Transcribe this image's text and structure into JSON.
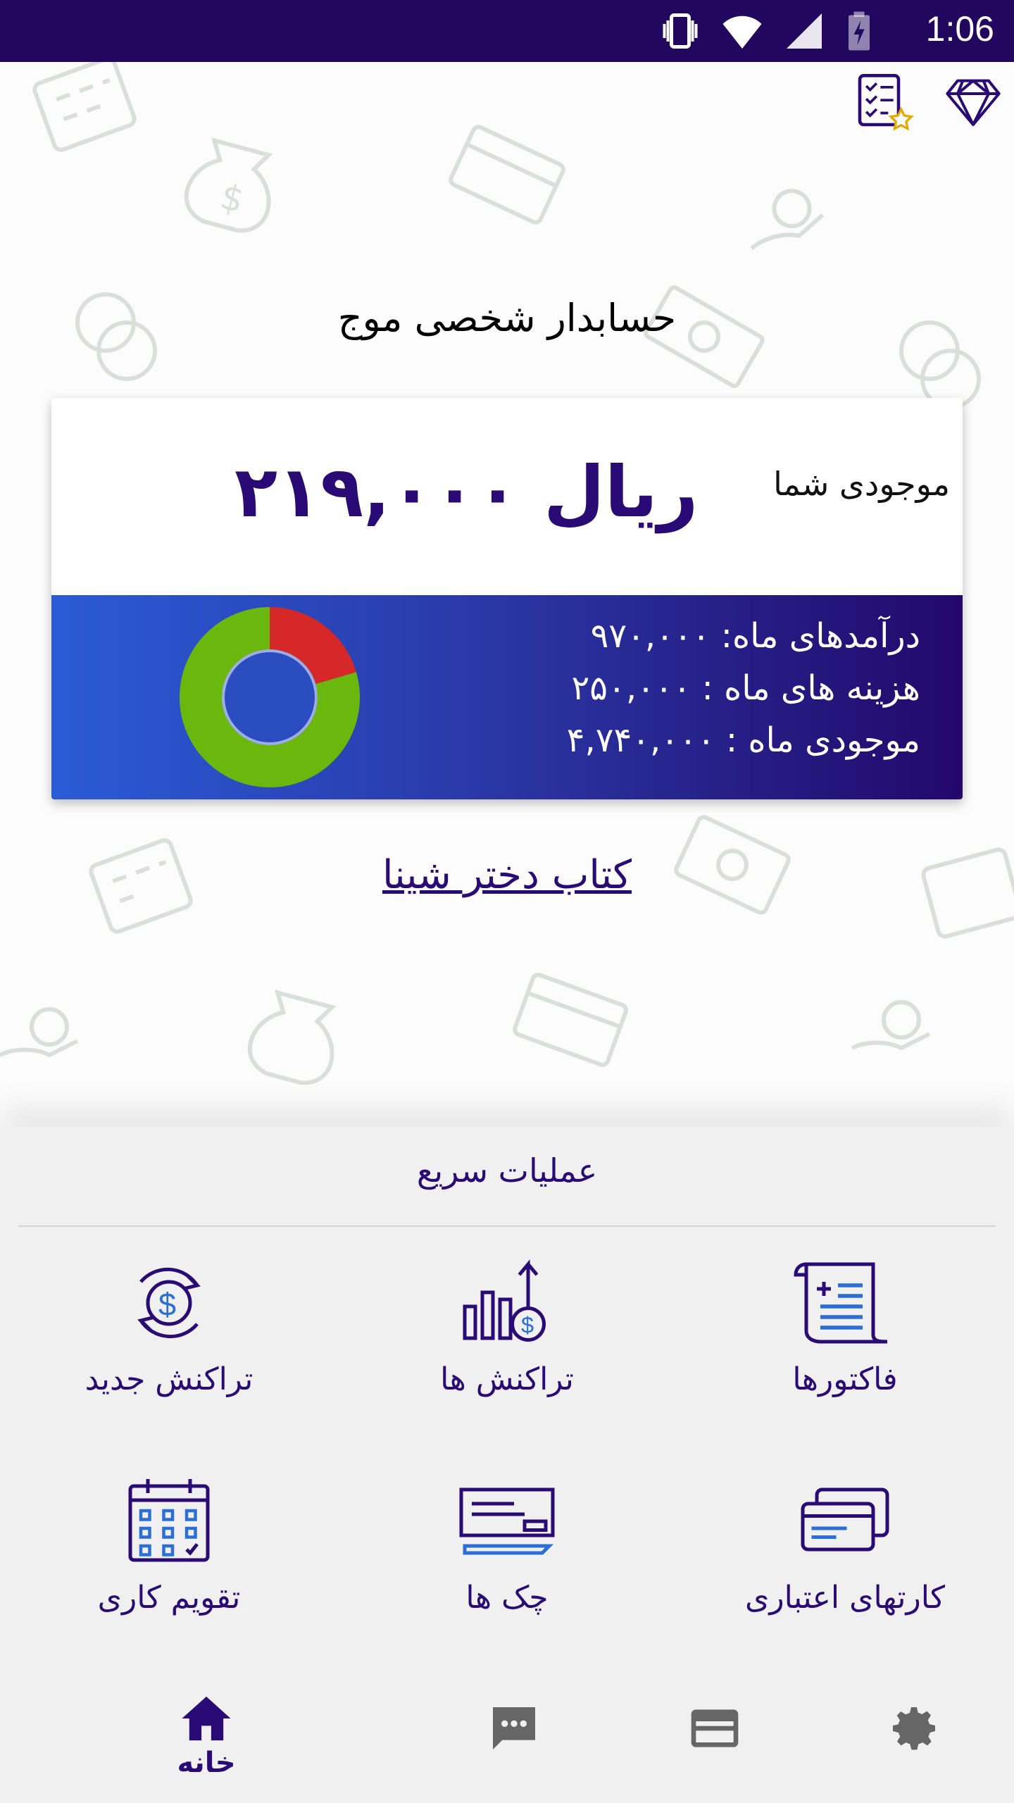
{
  "status_bar": {
    "time": "1:06",
    "icons": [
      "vibrate-icon",
      "wifi-icon",
      "signal-icon",
      "battery-charging-icon"
    ]
  },
  "header": {
    "icons": [
      "checklist-star-icon",
      "diamond-icon"
    ]
  },
  "app": {
    "title": "حسابدار شخصی موج"
  },
  "balance_card": {
    "label": "موجودی شما",
    "value": "۲۱۹,۰۰۰ ریال",
    "summary": {
      "income": "درآمدهای ماه: ۹۷۰,۰۰۰",
      "expense": "هزینه های ماه : ۲۵۰,۰۰۰",
      "balance": "موجودی ماه : ۴,۷۴۰,۰۰۰"
    },
    "donut": {
      "income_value": 970000,
      "expense_value": 250000,
      "income_color": "#6ab80e",
      "expense_color": "#d62828"
    }
  },
  "link": {
    "book": "کتاب دختر شینا"
  },
  "quick_actions": {
    "title": "عملیات سریع",
    "items": [
      {
        "label": "فاکتورها",
        "icon": "invoice-scroll-icon"
      },
      {
        "label": "تراکنش ها",
        "icon": "transactions-chart-icon"
      },
      {
        "label": "تراکنش جدید",
        "icon": "new-transaction-icon"
      },
      {
        "label": "کارتهای اعتباری",
        "icon": "credit-cards-icon"
      },
      {
        "label": "چک ها",
        "icon": "cheque-icon"
      },
      {
        "label": "تقویم کاری",
        "icon": "calendar-icon"
      }
    ]
  },
  "bottom_nav": {
    "items": [
      {
        "label": "خانه",
        "icon": "home-icon",
        "active": true
      },
      {
        "label": "",
        "icon": "chat-icon",
        "active": false
      },
      {
        "label": "",
        "icon": "card-icon",
        "active": false
      },
      {
        "label": "",
        "icon": "settings-gear-icon",
        "active": false
      }
    ]
  },
  "colors": {
    "primary": "#2a0a75",
    "status_bar": "#22075e",
    "income": "#6ab80e",
    "expense": "#d62828"
  }
}
